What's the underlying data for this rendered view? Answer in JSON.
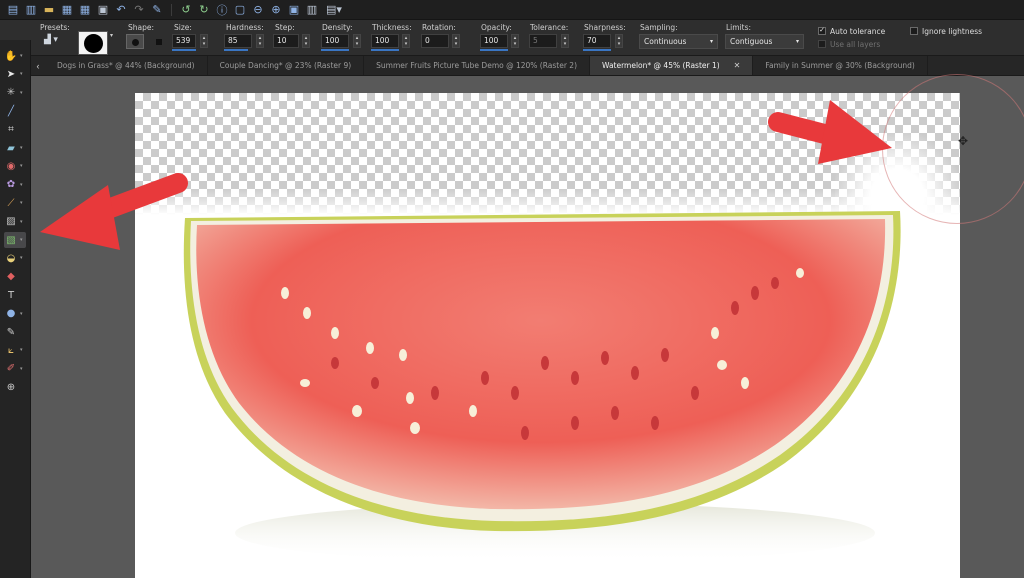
{
  "options": {
    "presets_label": "Presets:",
    "shape_label": "Shape:",
    "size": {
      "label": "Size:",
      "value": "539"
    },
    "hardness": {
      "label": "Hardness:",
      "value": "85"
    },
    "step": {
      "label": "Step:",
      "value": "10"
    },
    "density": {
      "label": "Density:",
      "value": "100"
    },
    "thickness": {
      "label": "Thickness:",
      "value": "100"
    },
    "rotation": {
      "label": "Rotation:",
      "value": "0"
    },
    "opacity": {
      "label": "Opacity:",
      "value": "100"
    },
    "tolerance": {
      "label": "Tolerance:",
      "value": "5"
    },
    "sharpness": {
      "label": "Sharpness:",
      "value": "70"
    },
    "sampling": {
      "label": "Sampling:",
      "value": "Continuous"
    },
    "limits": {
      "label": "Limits:",
      "value": "Contiguous"
    },
    "auto_tolerance": {
      "label": "Auto tolerance",
      "checked": true
    },
    "use_all_layers": {
      "label": "Use all layers",
      "checked": false
    },
    "ignore_lightness": {
      "label": "Ignore lightness",
      "checked": false
    }
  },
  "tabs": [
    {
      "label": "Dogs in Grass* @  44% (Background)",
      "active": false
    },
    {
      "label": "Couple Dancing* @  23% (Raster 9)",
      "active": false
    },
    {
      "label": "Summer Fruits Picture Tube Demo @ 120% (Raster 2)",
      "active": false
    },
    {
      "label": "Watermelon* @  45% (Raster 1)",
      "active": true
    },
    {
      "label": "Family in Summer @  30% (Background)",
      "active": false
    }
  ],
  "tools": [
    {
      "icon": "pan-hand-icon",
      "glyph": "✋"
    },
    {
      "icon": "pick-arrow-icon",
      "glyph": "➤"
    },
    {
      "icon": "magic-wand-icon",
      "glyph": "✳"
    },
    {
      "icon": "dropper-icon",
      "glyph": "╱"
    },
    {
      "icon": "crop-icon",
      "glyph": "⌗"
    },
    {
      "icon": "straighten-icon",
      "glyph": "▰"
    },
    {
      "icon": "red-eye-icon",
      "glyph": "◉"
    },
    {
      "icon": "clone-icon",
      "glyph": "✿"
    },
    {
      "icon": "paint-brush-icon",
      "glyph": "⟋"
    },
    {
      "icon": "smudge-icon",
      "glyph": "▨"
    },
    {
      "icon": "background-eraser-icon",
      "glyph": "▧"
    },
    {
      "icon": "fill-bucket-icon",
      "glyph": "◒"
    },
    {
      "icon": "paint-tube-icon",
      "glyph": "◆"
    },
    {
      "icon": "text-icon",
      "glyph": "T"
    },
    {
      "icon": "preset-shape-icon",
      "glyph": "●"
    },
    {
      "icon": "pen-icon",
      "glyph": "✎"
    },
    {
      "icon": "vector-pen-icon",
      "glyph": "⟀"
    },
    {
      "icon": "color-changer-icon",
      "glyph": "✐"
    },
    {
      "icon": "add-tool-icon",
      "glyph": "⊕"
    }
  ],
  "colors": {
    "accent": "#3a76c4",
    "arrow": "#e8393b",
    "checker": "#cbcbcb",
    "flesh": "#f06a60",
    "rind": "#c6d35c"
  }
}
